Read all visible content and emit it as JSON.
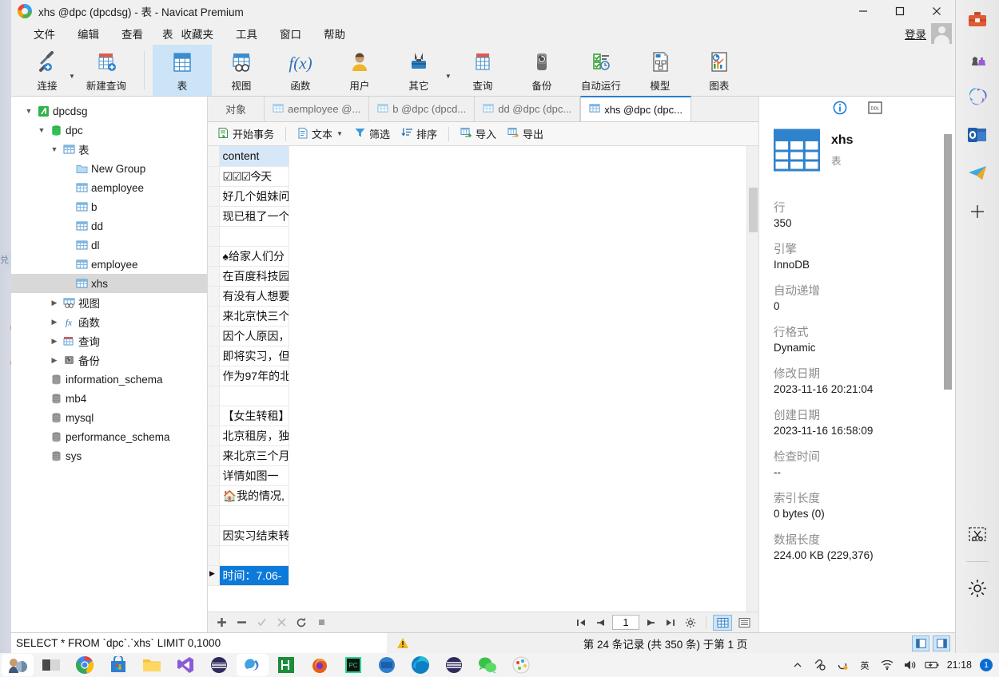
{
  "window": {
    "title": "xhs @dpc (dpcdsg) - 表 - Navicat Premium",
    "minimize": "minimize-icon",
    "maximize": "maximize-icon",
    "close": "close-icon"
  },
  "menubar": {
    "items": [
      "文件",
      "编辑",
      "查看",
      "表",
      "收藏夹",
      "工具",
      "窗口",
      "帮助"
    ],
    "login_label": "登录"
  },
  "toolbar": {
    "groups": [
      [
        {
          "label": "连接",
          "icon": "connection-icon",
          "caret": true
        },
        {
          "label": "新建查询",
          "icon": "new-query-icon",
          "caret": false
        }
      ],
      [
        {
          "label": "表",
          "icon": "table-icon",
          "active": true,
          "caret": false
        },
        {
          "label": "视图",
          "icon": "view-icon",
          "caret": false
        },
        {
          "label": "函数",
          "icon": "function-icon",
          "caret": false
        },
        {
          "label": "用户",
          "icon": "user-icon",
          "caret": false
        },
        {
          "label": "其它",
          "icon": "other-tools-icon",
          "caret": true
        },
        {
          "label": "查询",
          "icon": "query-icon",
          "caret": false
        },
        {
          "label": "备份",
          "icon": "backup-icon",
          "caret": false
        },
        {
          "label": "自动运行",
          "icon": "automation-icon",
          "caret": false
        },
        {
          "label": "模型",
          "icon": "model-icon",
          "caret": false
        },
        {
          "label": "图表",
          "icon": "chart-icon",
          "caret": false
        }
      ]
    ]
  },
  "sidebar": {
    "nodes": [
      {
        "label": "dpcdsg",
        "icon": "navicat-connection-icon",
        "depth": 0,
        "twisty": "open"
      },
      {
        "label": "dpc",
        "icon": "database-icon",
        "depth": 1,
        "twisty": "open"
      },
      {
        "label": "表",
        "icon": "table-folder-icon",
        "depth": 2,
        "twisty": "open"
      },
      {
        "label": "New Group",
        "icon": "folder-icon",
        "depth": 3,
        "twisty": "none"
      },
      {
        "label": "aemployee",
        "icon": "table-icon",
        "depth": 3,
        "twisty": "none"
      },
      {
        "label": "b",
        "icon": "table-icon",
        "depth": 3,
        "twisty": "none"
      },
      {
        "label": "dd",
        "icon": "table-icon",
        "depth": 3,
        "twisty": "none"
      },
      {
        "label": "dl",
        "icon": "table-icon",
        "depth": 3,
        "twisty": "none"
      },
      {
        "label": "employee",
        "icon": "table-icon",
        "depth": 3,
        "twisty": "none"
      },
      {
        "label": "xhs",
        "icon": "table-icon",
        "depth": 3,
        "twisty": "none",
        "selected": true
      },
      {
        "label": "视图",
        "icon": "view-folder-icon",
        "depth": 2,
        "twisty": "closed"
      },
      {
        "label": "函数",
        "icon": "function-folder-icon",
        "depth": 2,
        "twisty": "closed"
      },
      {
        "label": "查询",
        "icon": "query-folder-icon",
        "depth": 2,
        "twisty": "closed"
      },
      {
        "label": "备份",
        "icon": "backup-folder-icon",
        "depth": 2,
        "twisty": "closed"
      },
      {
        "label": "information_schema",
        "icon": "database-icon",
        "depth": 2,
        "twisty": "none"
      },
      {
        "label": "mb4",
        "icon": "database-icon",
        "depth": 2,
        "twisty": "none"
      },
      {
        "label": "mysql",
        "icon": "database-icon",
        "depth": 2,
        "twisty": "none"
      },
      {
        "label": "performance_schema",
        "icon": "database-icon",
        "depth": 2,
        "twisty": "none"
      },
      {
        "label": "sys",
        "icon": "database-icon",
        "depth": 2,
        "twisty": "none"
      }
    ]
  },
  "tabs": [
    {
      "label": "对象",
      "icon": "none",
      "active": false
    },
    {
      "label": "aemployee @...",
      "icon": "table-icon",
      "active": false
    },
    {
      "label": "b @dpc (dpcd...",
      "icon": "table-icon",
      "active": false
    },
    {
      "label": "dd @dpc (dpc...",
      "icon": "table-icon",
      "active": false
    },
    {
      "label": "xhs @dpc (dpc...",
      "icon": "table-icon",
      "active": true
    }
  ],
  "gridbar": {
    "buttons": [
      {
        "label": "开始事务",
        "icon": "transaction-icon",
        "caret": false
      },
      {
        "label": "文本",
        "icon": "text-icon",
        "caret": true
      },
      {
        "label": "筛选",
        "icon": "filter-icon",
        "caret": false
      },
      {
        "label": "排序",
        "icon": "sort-icon",
        "caret": false
      },
      {
        "label": "导入",
        "icon": "import-icon",
        "caret": false
      },
      {
        "label": "导出",
        "icon": "export-icon",
        "caret": false
      }
    ]
  },
  "grid": {
    "columns": [
      "content"
    ],
    "rows": [
      {
        "content": "☑☑☑今天"
      },
      {
        "content": "好几个姐妹问"
      },
      {
        "content": "现已租了一个"
      },
      {
        "content": ""
      },
      {
        "content": "♠给家人们分"
      },
      {
        "content": "在百度科技园"
      },
      {
        "content": "有没有人想要"
      },
      {
        "content": "来北京快三个"
      },
      {
        "content": "因个人原因，"
      },
      {
        "content": "即将实习，但"
      },
      {
        "content": "作为97年的北"
      },
      {
        "content": ""
      },
      {
        "content": "【女生转租】"
      },
      {
        "content": "北京租房，独"
      },
      {
        "content": "来北京三个月"
      },
      {
        "content": "详情如图一"
      },
      {
        "content": "🏠我的情况,"
      },
      {
        "content": ""
      },
      {
        "content": "因实习结束转"
      },
      {
        "content": ""
      },
      {
        "content": "时间：7.06-",
        "selected": true
      }
    ]
  },
  "pager": {
    "first": "first-page-icon",
    "prev": "prev-page-icon",
    "page_value": "1",
    "next": "next-page-icon",
    "last": "last-page-icon",
    "settings": "settings-icon",
    "grid_view": "grid-view-icon",
    "form_view": "form-view-icon",
    "add": "add-record-icon",
    "remove": "delete-record-icon",
    "confirm": "confirm-icon",
    "cancel": "cancel-icon",
    "refresh": "refresh-icon",
    "stop": "stop-icon"
  },
  "statusbar": {
    "sql": "SELECT * FROM `dpc`.`xhs` LIMIT 0,1000",
    "warning": "warning-icon",
    "count_text": "第 24 条记录 (共 350 条) 于第 1 页"
  },
  "infopanel": {
    "tab_info": "info-icon",
    "tab_ddl": "DDL",
    "title": "xhs",
    "subtitle": "表",
    "fields": [
      {
        "key": "行",
        "value": "350"
      },
      {
        "key": "引擎",
        "value": "InnoDB"
      },
      {
        "key": "自动递增",
        "value": "0"
      },
      {
        "key": "行格式",
        "value": "Dynamic"
      },
      {
        "key": "修改日期",
        "value": "2023-11-16 20:21:04"
      },
      {
        "key": "创建日期",
        "value": "2023-11-16 16:58:09"
      },
      {
        "key": "检查时间",
        "value": "--"
      },
      {
        "key": "索引长度",
        "value": "0 bytes (0)"
      },
      {
        "key": "数据长度",
        "value": "224.00 KB (229,376)"
      }
    ]
  },
  "edgebar": {
    "icons": [
      "toolbox-icon",
      "chess-icon",
      "microsoft365-icon",
      "outlook-icon",
      "telegram-icon",
      "add-icon",
      "snip-icon",
      "settings-icon"
    ]
  },
  "taskbar": {
    "items": [
      "profile-icon",
      "task-view-icon",
      "chrome-icon",
      "store-icon",
      "file-explorer-icon",
      "visual-studio-icon",
      "navicat-dark-icon",
      "navicat-icon",
      "hbuilder-icon",
      "firefox-icon",
      "pycharm-icon",
      "idea-icon",
      "edge-icon",
      "navicat2-icon",
      "wechat-icon",
      "paint-icon"
    ],
    "tray": [
      "chevron-up-icon",
      "usb-icon",
      "onedrive-icon",
      "ime-icon",
      "wifi-icon",
      "volume-icon",
      "battery-icon"
    ],
    "clock": "21:18",
    "badge": "1"
  },
  "colors": {
    "accent": "#0d7ada",
    "toolbar_active": "#cce4f7",
    "header": "#d6e8f7",
    "selection": "#d8d8d8"
  }
}
